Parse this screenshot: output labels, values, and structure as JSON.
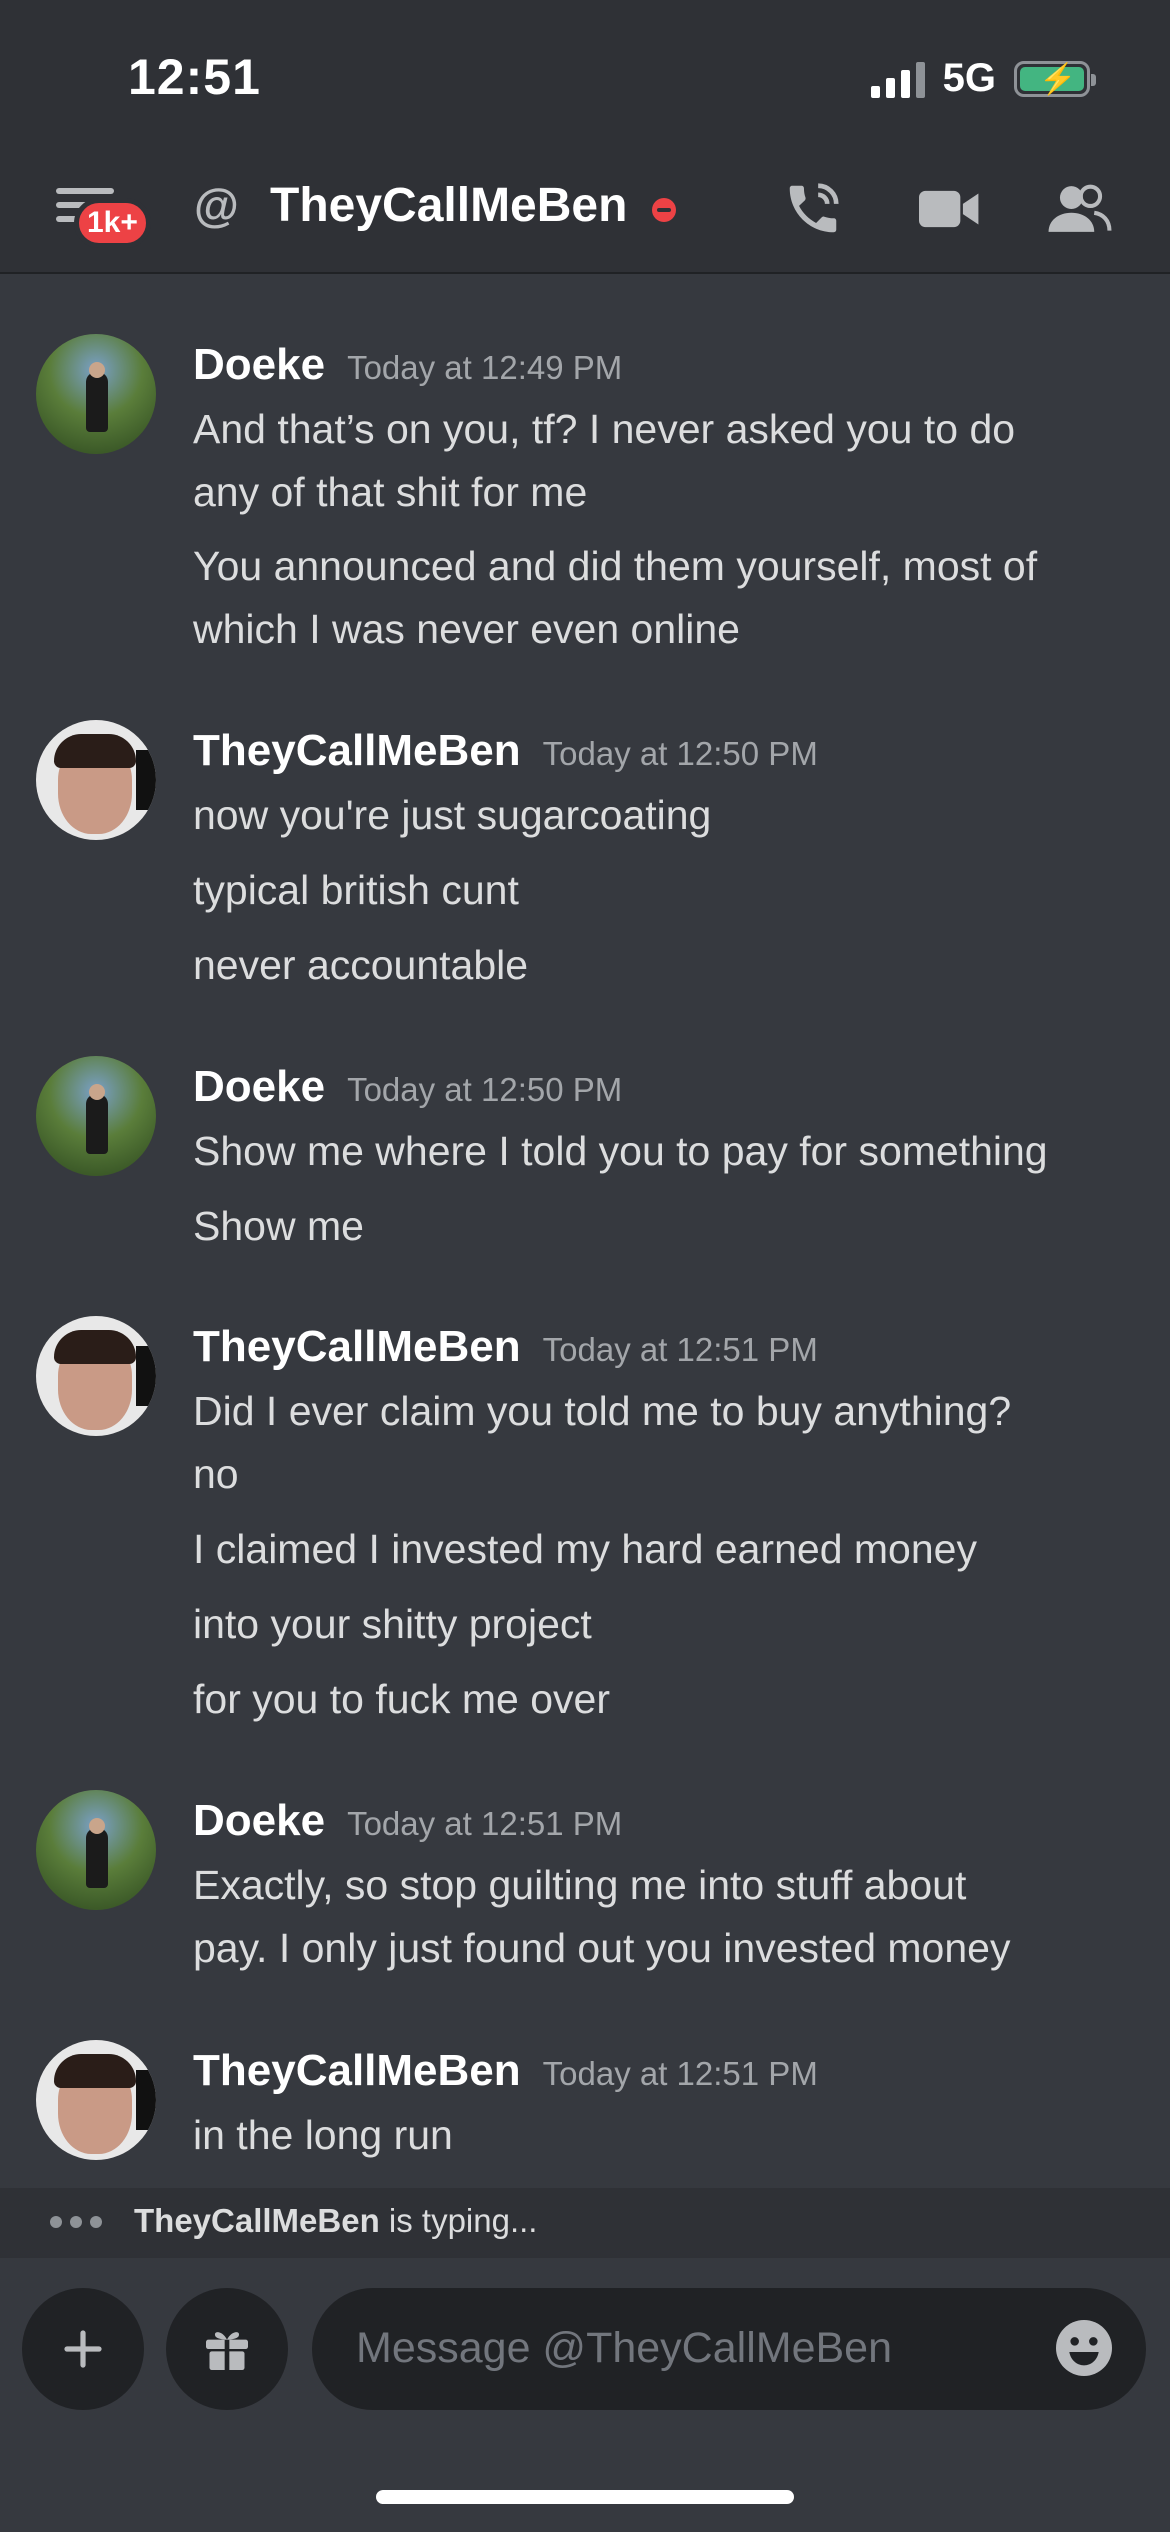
{
  "status_bar": {
    "time": "12:51",
    "network": "5G"
  },
  "header": {
    "notification_badge": "1k+",
    "at_symbol": "@",
    "title": "TheyCallMeBen",
    "status": "dnd",
    "icons": [
      "phone-call-icon",
      "video-camera-icon",
      "members-icon"
    ]
  },
  "messages": [
    {
      "author": "Doeke",
      "timestamp": "Today at 12:49 PM",
      "avatar": "doeke",
      "lines": [
        "And that’s on you, tf? I never asked you to do",
        "any of that shit for me",
        "You announced and did them yourself, most of",
        "which I was never even online"
      ]
    },
    {
      "author": "TheyCallMeBen",
      "timestamp": "Today at 12:50 PM",
      "avatar": "ben",
      "lines": [
        "now you're just sugarcoating",
        "typical british cunt",
        "never accountable"
      ]
    },
    {
      "author": "Doeke",
      "timestamp": "Today at 12:50 PM",
      "avatar": "doeke",
      "lines": [
        "Show me where I told you to pay for something",
        "Show me"
      ]
    },
    {
      "author": "TheyCallMeBen",
      "timestamp": "Today at 12:51 PM",
      "avatar": "ben",
      "lines": [
        "Did I ever claim you told me to buy anything?",
        "no",
        "I claimed I invested my hard earned money",
        "into your shitty project",
        "for you to fuck me over"
      ]
    },
    {
      "author": "Doeke",
      "timestamp": "Today at 12:51 PM",
      "avatar": "doeke",
      "lines": [
        "Exactly, so stop guilting me into stuff about",
        "pay. I only just found out you invested money"
      ]
    },
    {
      "author": "TheyCallMeBen",
      "timestamp": "Today at 12:51 PM",
      "avatar": "ben",
      "lines": [
        "in the long run"
      ]
    }
  ],
  "typing": {
    "user": "TheyCallMeBen",
    "suffix": " is typing..."
  },
  "composer": {
    "placeholder": "Message @TheyCallMeBen"
  },
  "colors": {
    "background": "#36393f",
    "header": "#2f3136",
    "input": "#202225",
    "danger": "#ed4245",
    "online": "#43b581"
  }
}
